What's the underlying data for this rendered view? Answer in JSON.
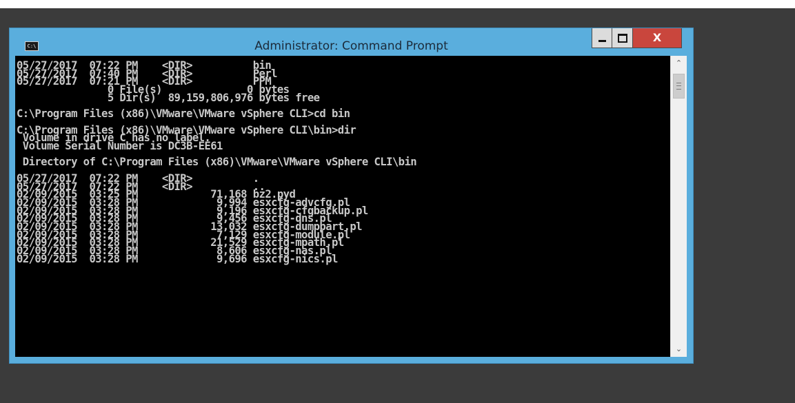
{
  "window": {
    "title": "Administrator: Command Prompt",
    "icon_label": "C:\\",
    "minimize_label": "",
    "maximize_label": "",
    "close_label": "X"
  },
  "console": {
    "lines": [
      "05/27/2017  07:22 PM    <DIR>          bin",
      "05/27/2017  07:40 PM    <DIR>          Perl",
      "05/27/2017  07:21 PM    <DIR>          PPM",
      "               0 File(s)              0 bytes",
      "               5 Dir(s)  89,159,806,976 bytes free",
      "",
      "C:\\Program Files (x86)\\VMware\\VMware vSphere CLI>cd bin",
      "",
      "C:\\Program Files (x86)\\VMware\\VMware vSphere CLI\\bin>dir",
      " Volume in drive C has no label.",
      " Volume Serial Number is DC3B-EE61",
      "",
      " Directory of C:\\Program Files (x86)\\VMware\\VMware vSphere CLI\\bin",
      "",
      "05/27/2017  07:22 PM    <DIR>          .",
      "05/27/2017  07:22 PM    <DIR>          ..",
      "02/09/2015  03:25 PM            71,168 bz2.pyd",
      "02/09/2015  03:28 PM             9,994 esxcfg-advcfg.pl",
      "02/09/2015  03:28 PM             9,196 esxcfg-cfgbackup.pl",
      "02/09/2015  03:28 PM             9,456 esxcfg-dns.pl",
      "02/09/2015  03:28 PM            13,032 esxcfg-dumppart.pl",
      "02/09/2015  03:28 PM             7,129 esxcfg-module.pl",
      "02/09/2015  03:28 PM            21,529 esxcfg-mpath.pl",
      "02/09/2015  03:28 PM             8,606 esxcfg-nas.pl",
      "02/09/2015  03:28 PM             9,696 esxcfg-nics.pl"
    ]
  },
  "icons": {
    "app": "command-prompt-icon",
    "minimize": "minimize-icon",
    "maximize": "maximize-icon",
    "close": "close-icon",
    "scroll_up": "chevron-up-icon",
    "scroll_down": "chevron-down-icon"
  },
  "colors": {
    "frame": "#5aaedd",
    "close_button": "#c9463d",
    "console_bg": "#000000",
    "console_text": "#c8c8c8"
  }
}
